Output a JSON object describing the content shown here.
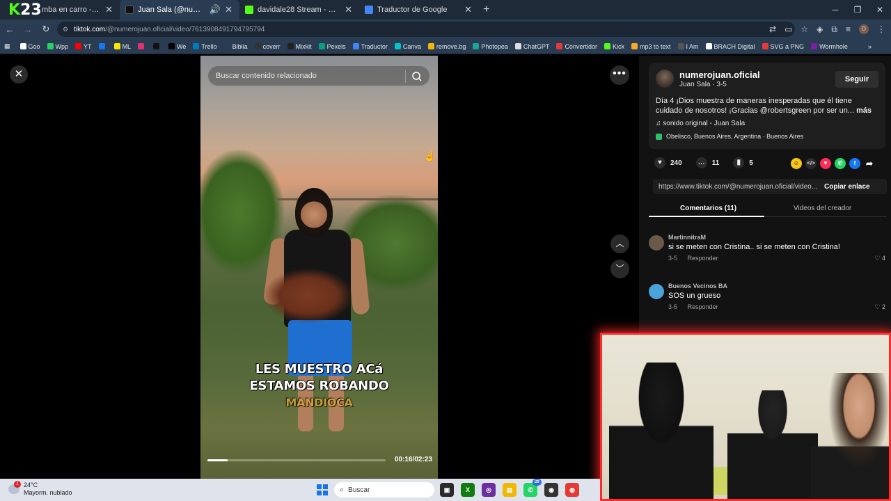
{
  "browser": {
    "tabs": [
      {
        "title": "mba en carro - YouTube",
        "color": "#ff0000",
        "active": false
      },
      {
        "title": "Juan Sala (@numerojuan.ofi",
        "color": "#111111",
        "active": true
      },
      {
        "title": "davidale28 Stream - Watch Live",
        "color": "#53fc18",
        "active": false
      },
      {
        "title": "Traductor de Google",
        "color": "#4285f4",
        "active": false
      }
    ],
    "kick_overlay": {
      "k": "K",
      "num": "23"
    },
    "url_domain": "tiktok.com",
    "url_path": "/@numerojuan.oficial/video/7613908491794795794",
    "profile_initial": "D",
    "bookmarks": [
      {
        "label": "Goo",
        "color": "#ffffff"
      },
      {
        "label": "Wpp",
        "color": "#25d366"
      },
      {
        "label": "YT",
        "color": "#ff0000"
      },
      {
        "label": "",
        "color": "#1877f2"
      },
      {
        "label": "ML",
        "color": "#ffe600"
      },
      {
        "label": "",
        "color": "#e1306c"
      },
      {
        "label": "",
        "color": "#111111"
      },
      {
        "label": "We",
        "color": "#000000"
      },
      {
        "label": "Trello",
        "color": "#0079bf"
      },
      {
        "label": "Biblia",
        "color": "#2a3c52"
      },
      {
        "label": "coverr",
        "color": "#333333"
      },
      {
        "label": "Mixkit",
        "color": "#222222"
      },
      {
        "label": "Pexels",
        "color": "#05a081"
      },
      {
        "label": "Traductor",
        "color": "#4285f4"
      },
      {
        "label": "Canva",
        "color": "#00c4cc"
      },
      {
        "label": "remove.bg",
        "color": "#f2b705"
      },
      {
        "label": "Photopea",
        "color": "#18a497"
      },
      {
        "label": "ChatGPT",
        "color": "#dddddd"
      },
      {
        "label": "Convertidor",
        "color": "#e53935"
      },
      {
        "label": "Kick",
        "color": "#53fc18"
      },
      {
        "label": "mp3 to text",
        "color": "#f9a825"
      },
      {
        "label": "I Am",
        "color": "#555555"
      },
      {
        "label": "BRACH Digital",
        "color": "#ffffff"
      },
      {
        "label": "SVG a PNG",
        "color": "#e53935"
      },
      {
        "label": "Wormhole",
        "color": "#7b1fa2"
      }
    ]
  },
  "video": {
    "search_placeholder": "Buscar contenido relacionado",
    "caption_line1": "LES MUESTRO ACá",
    "caption_line2": "ESTAMOS ROBANDO",
    "caption_line3": "MANDIOCA",
    "timecode": "00:16/02:23",
    "progress": 0.112
  },
  "post": {
    "username": "numerojuan.oficial",
    "meta": "Juan Sala · 3-5",
    "follow_label": "Seguir",
    "description": "Día 4 ¡Dios muestra de maneras inesperadas que él tiene cuidado de nosotros! ¡Gracias @robertsgreen por ser un...",
    "more_label": "más",
    "sound": "sonido original - Juan Sala",
    "location": "Obelisco, Buenos Aires, Argentina · Buenos Aires",
    "likes": "240",
    "comments_count": "11",
    "saves": "5",
    "link": "https://www.tiktok.com/@numerojuan.oficial/video...",
    "copy_label": "Copiar enlace",
    "tab_comments": "Comentarios (11)",
    "tab_creator": "Videos del creador"
  },
  "comments": [
    {
      "user": "MartinnitraM",
      "text": "si se meten con Cristina.. si se meten con Cristina!",
      "date": "3-5",
      "reply": "Responder",
      "likes": "4",
      "avatar_color": "#6b5a4a"
    },
    {
      "user": "Buenos Vecinos BA",
      "text": "SOS un grueso",
      "date": "3-5",
      "reply": "Responder",
      "likes": "2",
      "avatar_color": "#4aa3d9"
    }
  ],
  "taskbar": {
    "temp": "24°C",
    "weather": "Mayorm. nublado",
    "notif": "1",
    "search_label": "Buscar",
    "whatsapp_badge": "29"
  }
}
